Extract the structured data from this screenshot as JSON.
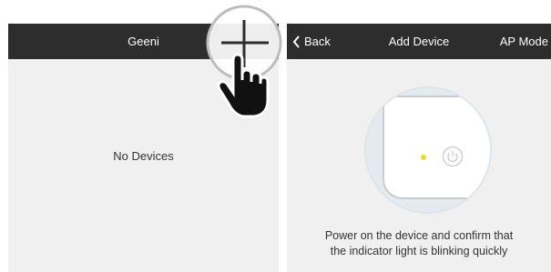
{
  "left_screen": {
    "title": "Geeni",
    "empty_state": "No Devices",
    "add_button_icon": "plus-icon",
    "gesture_icon": "tap-hand-icon"
  },
  "right_screen": {
    "back_label": "Back",
    "back_icon": "chevron-left-icon",
    "title": "Add Device",
    "ap_mode_label": "AP Mode",
    "indicator_light_color": "#e8dd2a",
    "power_icon": "power-icon",
    "instruction_line1": "Power on the device and confirm that",
    "instruction_line2": "the indicator light is blinking quickly"
  },
  "colors": {
    "navbar": "#2d2d2d",
    "background": "#f0f0f0"
  }
}
